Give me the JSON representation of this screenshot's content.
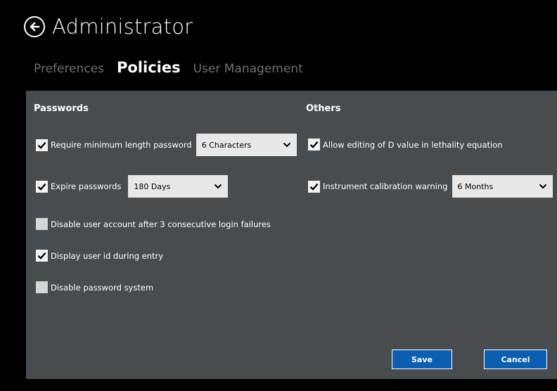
{
  "window": {
    "title": "Administrator"
  },
  "icons": {
    "back": "back-arrow-circle-icon",
    "checkmark": "checkmark-icon",
    "dropdown": "chevron-down-icon"
  },
  "colors": {
    "background": "#000000",
    "panel": "#494c4e",
    "tab_inactive": "#707070",
    "button_accent": "#0b5fb3",
    "field_bg": "#e8e8e8"
  },
  "tabs": [
    {
      "label": "Preferences",
      "active": false
    },
    {
      "label": "Policies",
      "active": true
    },
    {
      "label": "User Management",
      "active": false
    }
  ],
  "passwords": {
    "heading": "Passwords",
    "min_length": {
      "label": "Require minimum length password",
      "checked": true,
      "value": "6 Characters"
    },
    "expire": {
      "label": "Expire passwords",
      "checked": true,
      "value": "180 Days"
    },
    "disable_account": {
      "label": "Disable user account after 3 consecutive login failures",
      "checked": false
    },
    "display_user_id": {
      "label": "Display user id during entry",
      "checked": true
    },
    "disable_system": {
      "label": "Disable password system",
      "checked": false
    }
  },
  "others": {
    "heading": "Others",
    "allow_d_value": {
      "label": "Allow editing of D value in lethality equation",
      "checked": true
    },
    "calibration": {
      "label": "Instrument calibration warning",
      "checked": true,
      "value": "6 Months"
    }
  },
  "actions": {
    "save_label": "Save",
    "cancel_label": "Cancel"
  }
}
